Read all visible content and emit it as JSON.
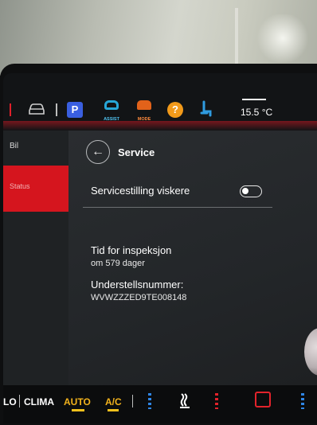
{
  "status_bar": {
    "park_label": "P",
    "assist_label": "ASSIST",
    "mode_label": "MODE",
    "help_label": "?",
    "temperature": "15.5 °C"
  },
  "left_nav": {
    "items": [
      {
        "label": "Bil"
      },
      {
        "label": "Status"
      }
    ]
  },
  "main": {
    "title": "Service",
    "wiper_setting_label": "Servicestilling viskere",
    "wiper_toggle_on": false,
    "inspection_title": "Tid for inspeksjon",
    "inspection_value": "om 579 dager",
    "vin_title": "Understellsnummer:",
    "vin_value": "WVWZZZED9TE008148"
  },
  "climate_bar": {
    "left_temp": "LO",
    "clima_label": "CLIMA",
    "auto_label": "AUTO",
    "ac_label": "A/C"
  },
  "colors": {
    "accent_red": "#d5151e",
    "park_blue": "#3a5fe0",
    "assist_blue": "#27a7d8",
    "mode_orange": "#e2621a",
    "auto_yellow": "#f2b21c"
  }
}
